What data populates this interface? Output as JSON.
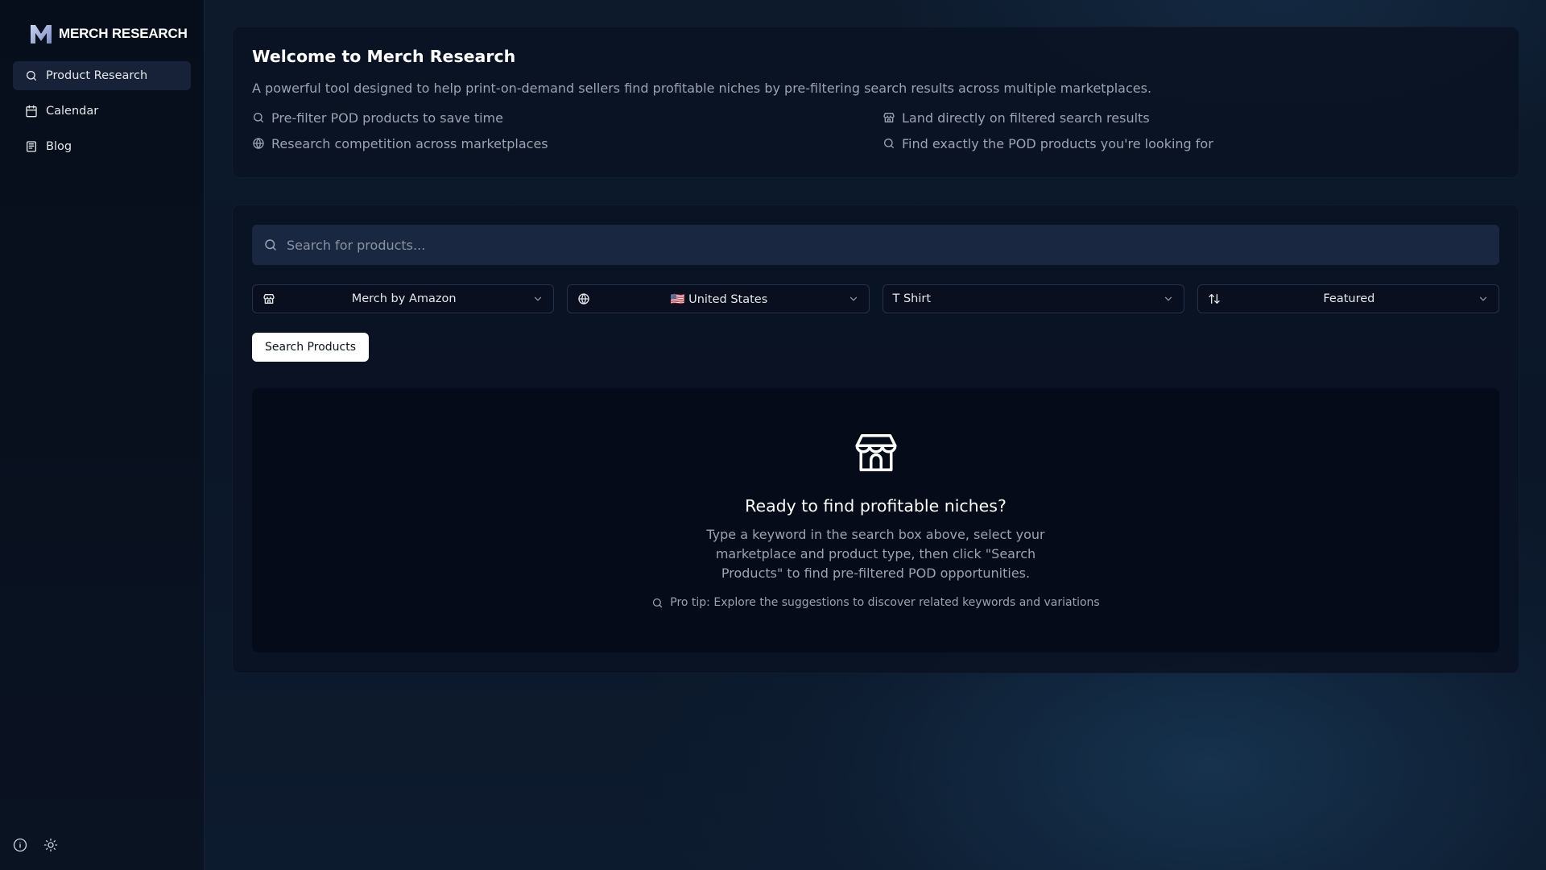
{
  "brand": {
    "name": "MERCH RESEARCH",
    "logo_letter": "M"
  },
  "sidebar": {
    "items": [
      {
        "label": "Product Research",
        "icon": "search-icon",
        "active": true
      },
      {
        "label": "Calendar",
        "icon": "calendar-icon",
        "active": false
      },
      {
        "label": "Blog",
        "icon": "newspaper-icon",
        "active": false
      }
    ],
    "footer_icons": [
      "info-icon",
      "sun-icon"
    ]
  },
  "welcome": {
    "title": "Welcome to Merch Research",
    "description": "A powerful tool designed to help print-on-demand sellers find profitable niches by pre-filtering search results across multiple marketplaces.",
    "features": [
      {
        "label": "Pre-filter POD products to save time",
        "icon": "search-icon"
      },
      {
        "label": "Land directly on filtered search results",
        "icon": "store-icon"
      },
      {
        "label": "Research competition across marketplaces",
        "icon": "globe-icon"
      },
      {
        "label": "Find exactly the POD products you're looking for",
        "icon": "search-icon"
      }
    ]
  },
  "search": {
    "placeholder": "Search for products...",
    "value": "",
    "marketplace": "Merch by Amazon",
    "country": "🇺🇸 United States",
    "product_type": "T Shirt",
    "sort": "Featured",
    "button_label": "Search Products"
  },
  "empty_state": {
    "icon": "store-icon",
    "title": "Ready to find profitable niches?",
    "body": "Type a keyword in the search box above, select your marketplace and product type, then click \"Search Products\" to find pre-filtered POD opportunities.",
    "tip": "Pro tip: Explore the suggestions to discover related keywords and variations"
  },
  "colors": {
    "sidebar_bg": "#070e1b",
    "active_nav_bg": "#172238",
    "card_bg": "#0a1222",
    "input_bg": "#1a2740",
    "muted_text": "#9ca3af",
    "button_bg": "#ffffff"
  }
}
